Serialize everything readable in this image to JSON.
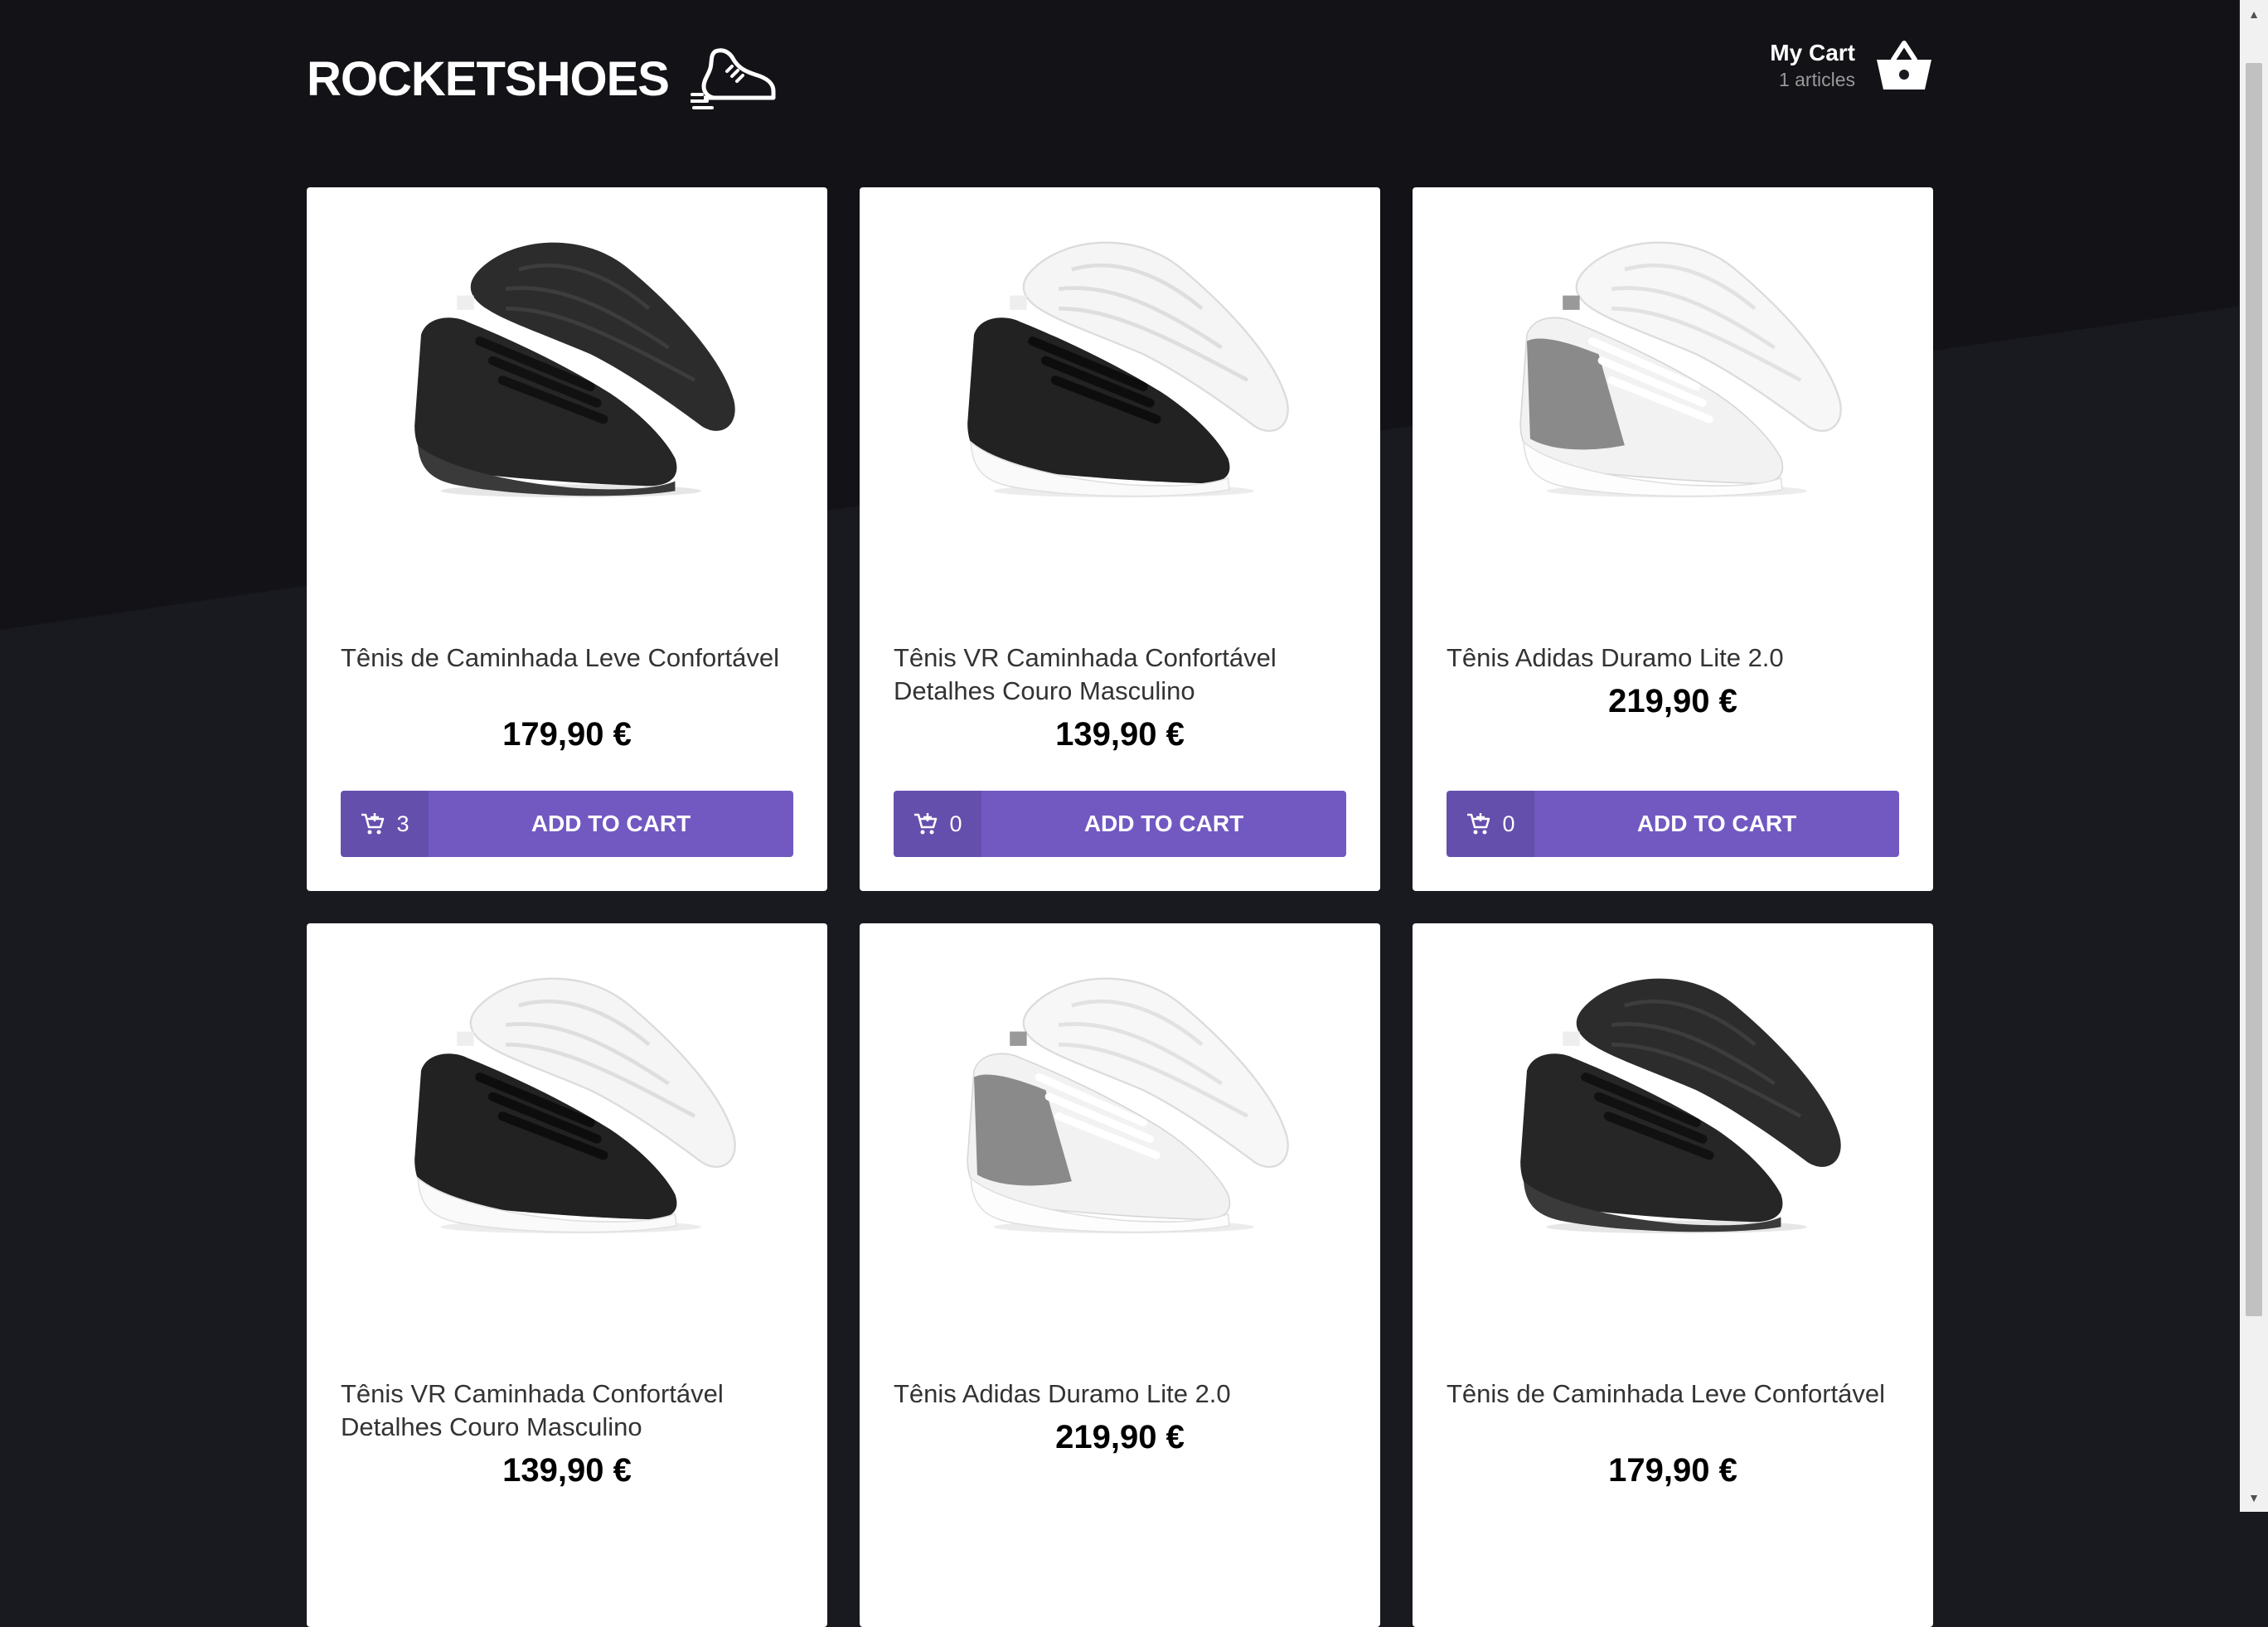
{
  "brand": {
    "name": "ROCKETSHOES",
    "logo_icon": "running-shoe-icon"
  },
  "cart": {
    "title": "My Cart",
    "count_label": "1 articles",
    "icon": "basket-icon"
  },
  "colors": {
    "background": "#191920",
    "accent": "#7159c1",
    "card": "#ffffff"
  },
  "products": [
    {
      "title": "Tênis de Caminhada Leve Confortável",
      "price": "179,90 €",
      "amount": "3",
      "button_label": "ADD TO CART",
      "image": "sneaker-black"
    },
    {
      "title": "Tênis VR Caminhada Confortável Detalhes Couro Masculino",
      "price": "139,90 €",
      "amount": "0",
      "button_label": "ADD TO CART",
      "image": "sneaker-black-white-sole"
    },
    {
      "title": "Tênis Adidas Duramo Lite 2.0",
      "price": "219,90 €",
      "amount": "0",
      "button_label": "ADD TO CART",
      "image": "sneaker-white-gray"
    },
    {
      "title": "Tênis VR Caminhada Confortável Detalhes Couro Masculino",
      "price": "139,90 €",
      "amount": "",
      "button_label": "",
      "image": "sneaker-black-white-sole"
    },
    {
      "title": "Tênis Adidas Duramo Lite 2.0",
      "price": "219,90 €",
      "amount": "",
      "button_label": "",
      "image": "sneaker-white-gray"
    },
    {
      "title": "Tênis de Caminhada Leve Confortável",
      "price": "179,90 €",
      "amount": "",
      "button_label": "",
      "image": "sneaker-black"
    }
  ]
}
